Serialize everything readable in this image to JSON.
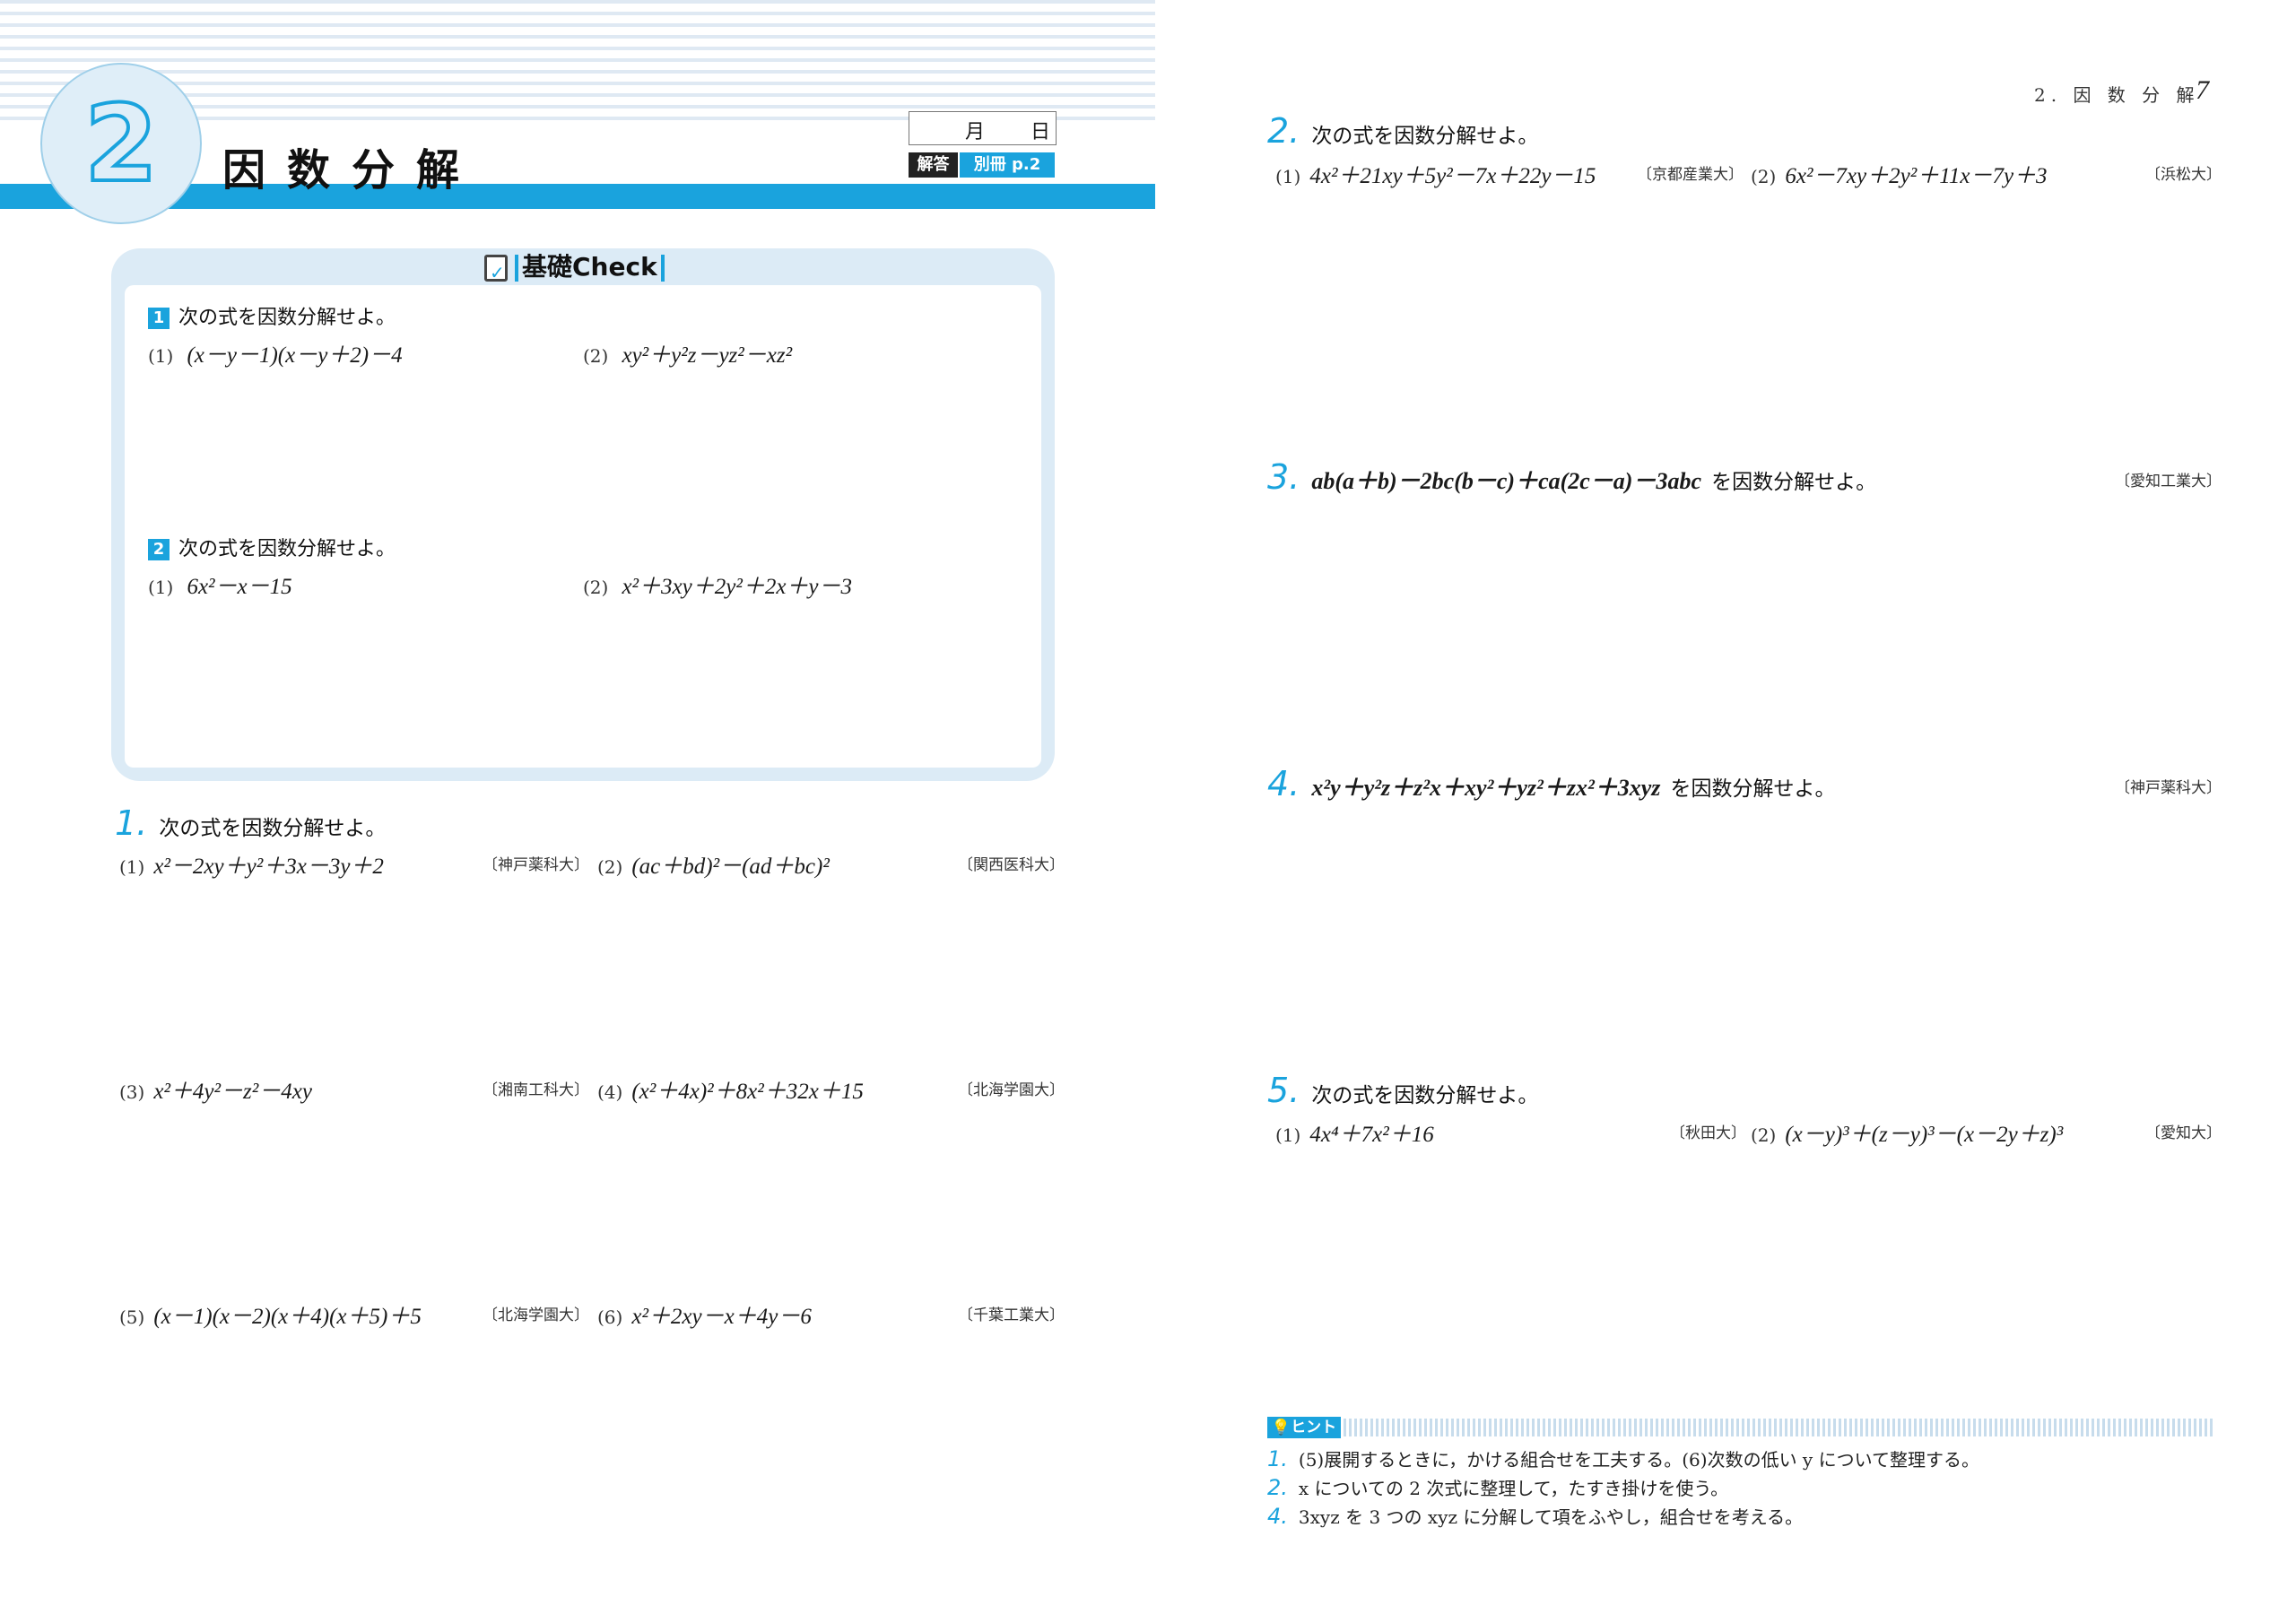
{
  "chapter": {
    "number": "2",
    "title": "因数分解"
  },
  "date_box": {
    "month": "月",
    "day": "日"
  },
  "answer": {
    "label": "解答",
    "ref": "別冊 p.2"
  },
  "check": {
    "title": "基礎Check",
    "q1": {
      "num": "1",
      "text": "次の式を因数分解せよ。",
      "items": [
        {
          "label": "(1)",
          "expr": "(x－y－1)(x－y＋2)－4"
        },
        {
          "label": "(2)",
          "expr": "xy²＋y²z－yz²－xz²"
        }
      ]
    },
    "q2": {
      "num": "2",
      "text": "次の式を因数分解せよ。",
      "items": [
        {
          "label": "(1)",
          "expr": "6x²－x－15"
        },
        {
          "label": "(2)",
          "expr": "x²＋3xy＋2y²＋2x＋y－3"
        }
      ]
    }
  },
  "p1": {
    "num": "1.",
    "text": "次の式を因数分解せよ。",
    "items": [
      {
        "label": "(1)",
        "expr": "x²－2xy＋y²＋3x－3y＋2",
        "source": "〔神戸薬科大〕"
      },
      {
        "label": "(2)",
        "expr": "(ac＋bd)²－(ad＋bc)²",
        "source": "〔関西医科大〕"
      },
      {
        "label": "(3)",
        "expr": "x²＋4y²－z²－4xy",
        "source": "〔湘南工科大〕"
      },
      {
        "label": "(4)",
        "expr": "(x²＋4x)²＋8x²＋32x＋15",
        "source": "〔北海学園大〕"
      },
      {
        "label": "(5)",
        "expr": "(x－1)(x－2)(x＋4)(x＋5)＋5",
        "source": "〔北海学園大〕"
      },
      {
        "label": "(6)",
        "expr": "x²＋2xy－x＋4y－6",
        "source": "〔千葉工業大〕"
      }
    ]
  },
  "running_head": "2. 因 数 分 解",
  "page_number": "7",
  "p2": {
    "num": "2.",
    "text": "次の式を因数分解せよ。",
    "items": [
      {
        "label": "(1)",
        "expr": "4x²＋21xy＋5y²－7x＋22y－15",
        "source": "〔京都産業大〕"
      },
      {
        "label": "(2)",
        "expr": "6x²－7xy＋2y²＋11x－7y＋3",
        "source": "〔浜松大〕"
      }
    ]
  },
  "p3": {
    "num": "3.",
    "expr": "ab(a＋b)－2bc(b－c)＋ca(2c－a)－3abc",
    "text": "を因数分解せよ。",
    "source": "〔愛知工業大〕"
  },
  "p4": {
    "num": "4.",
    "expr": "x²y＋y²z＋z²x＋xy²＋yz²＋zx²＋3xyz",
    "text": "を因数分解せよ。",
    "source": "〔神戸薬科大〕"
  },
  "p5": {
    "num": "5.",
    "text": "次の式を因数分解せよ。",
    "items": [
      {
        "label": "(1)",
        "expr": "4x⁴＋7x²＋16",
        "source": "〔秋田大〕"
      },
      {
        "label": "(2)",
        "expr": "(x－y)³＋(z－y)³－(x－2y＋z)³",
        "source": "〔愛知大〕"
      }
    ]
  },
  "hint": {
    "label": "ヒント",
    "lines": [
      {
        "num": "1.",
        "text": "(5)展開するときに，かける組合せを工夫する。(6)次数の低い y について整理する。"
      },
      {
        "num": "2.",
        "text": "x についての 2 次式に整理して，たすき掛けを使う。"
      },
      {
        "num": "4.",
        "text": "3xyz を 3 つの xyz に分解して項をふやし，組合せを考える。"
      }
    ]
  },
  "colors": {
    "accent": "#1aa3dd",
    "panel": "#dcebf6"
  }
}
